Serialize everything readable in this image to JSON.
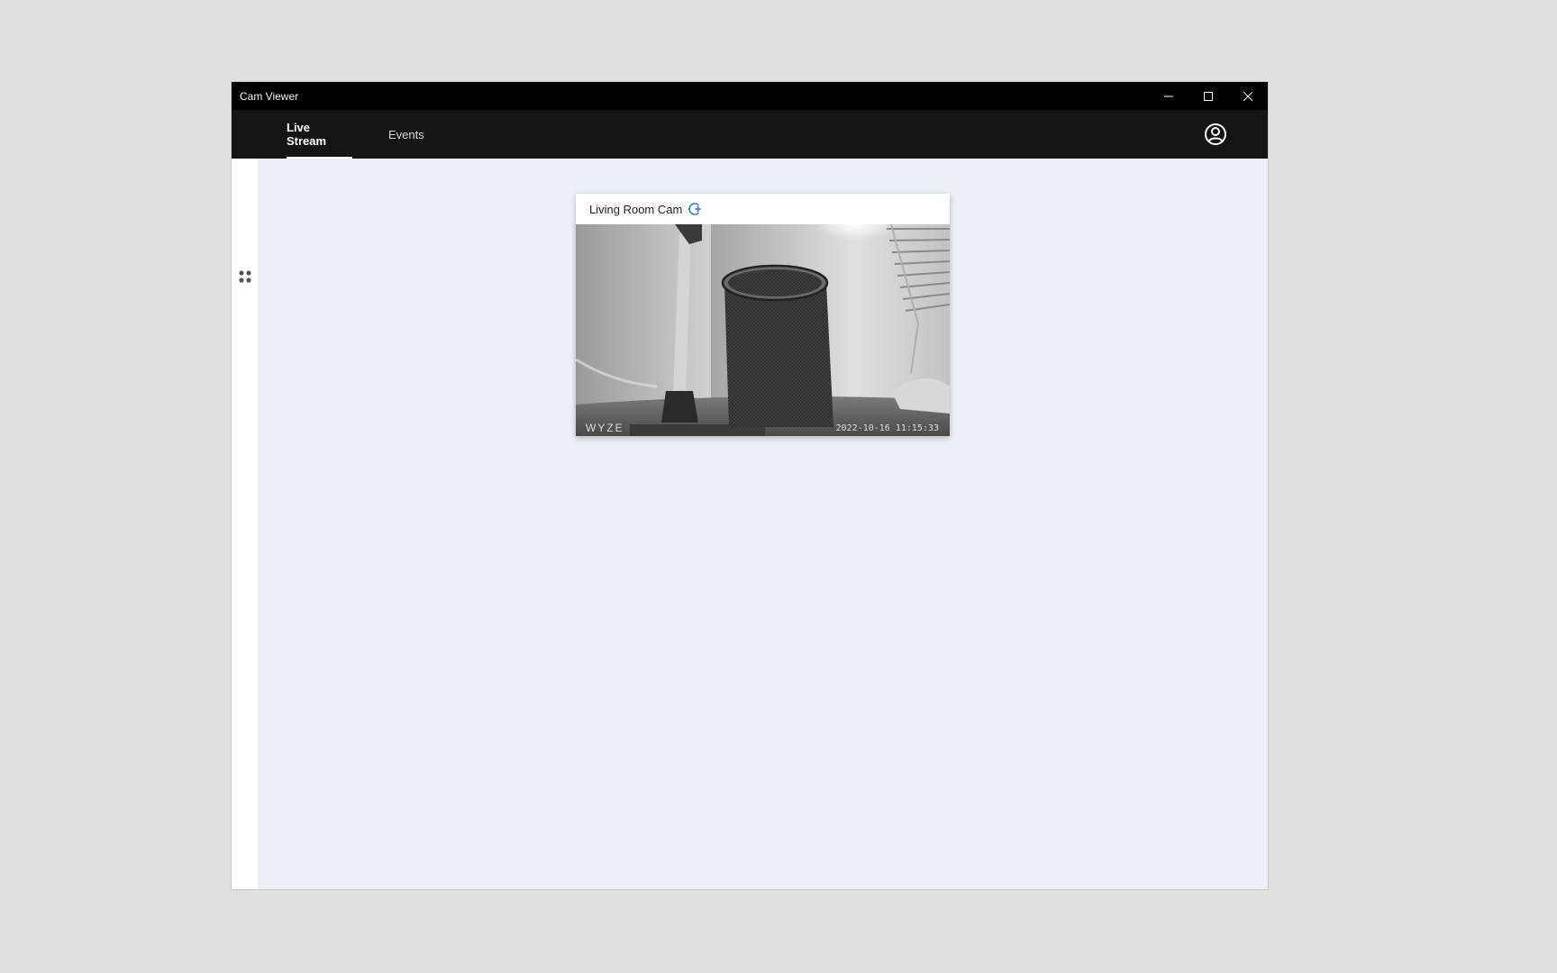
{
  "window": {
    "title": "Cam Viewer",
    "controls": [
      "minimize-icon",
      "maximize-icon",
      "close-icon"
    ]
  },
  "nav": {
    "tabs": [
      {
        "label": "Live Stream",
        "active": true
      },
      {
        "label": "Events",
        "active": false
      }
    ],
    "account_icon": "account-circle-icon"
  },
  "sidebar": {
    "toggle_icon": "grid-dots-icon"
  },
  "camera_card": {
    "name": "Living Room Cam",
    "action_icon": "add-circle-icon",
    "watermark": "WYZE",
    "timestamp": "2022-10-16 11:15:33"
  },
  "colors": {
    "titlebar": "#000000",
    "navbar": "#141414",
    "content_bg": "#eaf0f5",
    "accent": "#3b7ddd"
  }
}
